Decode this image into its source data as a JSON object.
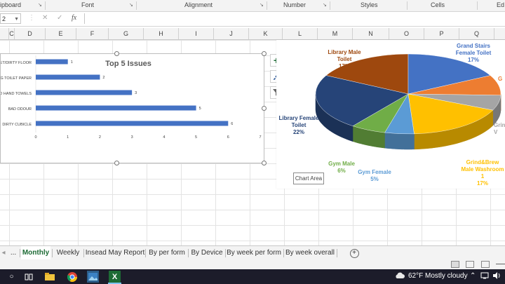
{
  "ribbon": {
    "groups": [
      "ipboard",
      "Font",
      "Alignment",
      "Number",
      "Styles",
      "Cells",
      "Ed"
    ]
  },
  "formula_bar": {
    "name_box": "2",
    "fx_label": "fx",
    "cancel_glyph": "✕",
    "enter_glyph": "✓",
    "formula": ""
  },
  "columns": [
    "C",
    "D",
    "E",
    "F",
    "G",
    "H",
    "I",
    "J",
    "K",
    "L",
    "M",
    "N",
    "O",
    "P",
    "Q"
  ],
  "bar_chart": {
    "chart_data": {
      "type": "bar",
      "orientation": "horizontal",
      "title": "Top 5 Issues",
      "categories": [
        "ET/DIRTY FLOOR",
        "G TOILET PAPER",
        "D HAND TOWELS",
        "BAD ODOUR",
        "DIRTY CUBICLE"
      ],
      "values": [
        1,
        2,
        3,
        5,
        6
      ],
      "xlim": [
        0,
        7
      ],
      "x_ticks": [
        "0",
        "1",
        "2",
        "3",
        "4",
        "5",
        "6",
        "7"
      ],
      "color": "#4472c4"
    }
  },
  "pie_chart": {
    "chart_data": {
      "type": "pie",
      "style": "3d",
      "slices": [
        {
          "label": "Library Male Toilet",
          "value": 17,
          "display": "17%",
          "color": "#9e480e"
        },
        {
          "label": "Grand Stairs Female Toilet",
          "value": 17,
          "display": "17%",
          "color": "#4472c4"
        },
        {
          "label": "G",
          "value": 8,
          "display": "",
          "color": "#ed7d31"
        },
        {
          "label": "Grind V",
          "value": 6,
          "display": "",
          "color": "#a5a5a5"
        },
        {
          "label": "Grind&Brew Male Washroom 1",
          "value": 17,
          "display": "17%",
          "color": "#ffc000"
        },
        {
          "label": "Gym Female",
          "value": 5,
          "display": "5%",
          "color": "#5b9bd5"
        },
        {
          "label": "Gym Male",
          "value": 6,
          "display": "6%",
          "color": "#70ad47"
        },
        {
          "label": "Library Female Toilet",
          "value": 22,
          "display": "22%",
          "color": "#264478"
        }
      ]
    },
    "tooltip": "Chart Area",
    "labels": {
      "lib_male": "Library Male Toilet",
      "lib_male_pct": "17%",
      "grand_stairs": "Grand Stairs Female Toilet",
      "grand_stairs_pct": "17%",
      "g_cut": "G",
      "grind_cut": "Grind",
      "v_cut": "V",
      "lib_female": "Library Female Toilet",
      "lib_female_pct": "22%",
      "gym_male": "Gym Male",
      "gym_male_pct": "6%",
      "gym_female": "Gym Female",
      "gym_female_pct": "5%",
      "grind_brew": "Grind&Brew Male Washroom 1",
      "grind_brew_pct": "17%"
    },
    "colors": {
      "lib_male": "#9e480e",
      "grand_stairs": "#4472c4",
      "g": "#ed7d31",
      "grind": "#a5a5a5",
      "lib_female": "#264478",
      "gym_male": "#70ad47",
      "gym_female": "#5b9bd5",
      "grind_brew": "#ffc000"
    }
  },
  "side_buttons": {
    "add": "+",
    "style": "brush-icon",
    "filter": "filter-icon"
  },
  "sheet_tabs": {
    "more": "...",
    "tabs": [
      "Monthly",
      "Weekly",
      "Insead May  Report",
      "By per form",
      "By Device",
      "By week per form",
      "By week overall"
    ],
    "active": "Monthly",
    "add": "+"
  },
  "taskbar": {
    "temperature": "62°F",
    "weather": "Mostly cloudy",
    "excel_label": "X"
  }
}
